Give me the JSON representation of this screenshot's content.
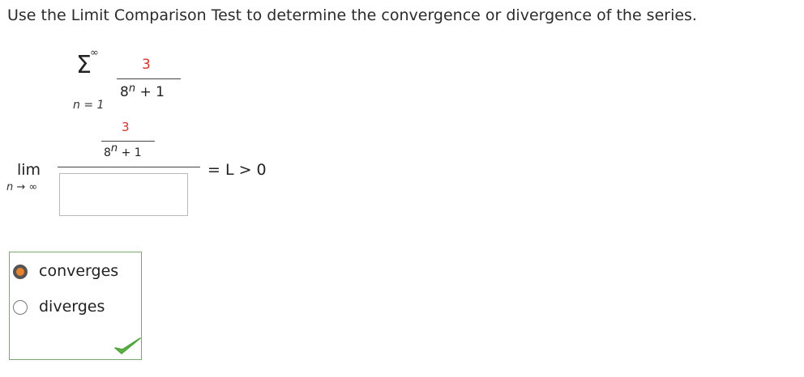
{
  "question": "Use the Limit Comparison Test to determine the convergence or divergence of the series.",
  "series": {
    "upper_limit": "∞",
    "sigma": "Σ",
    "lower_limit": "n = 1",
    "numerator": "3",
    "denominator_base": "8",
    "denominator_exp": "n",
    "denominator_tail": " + 1"
  },
  "limit": {
    "label": "lim",
    "subscript": "n → ∞",
    "inner_numerator": "3",
    "inner_denominator_base": "8",
    "inner_denominator_exp": "n",
    "inner_denominator_tail": " + 1",
    "answer_value": "",
    "result": "= L > 0"
  },
  "choices": [
    {
      "label": "converges",
      "selected": true
    },
    {
      "label": "diverges",
      "selected": false
    }
  ],
  "colors": {
    "accent_red": "#d9322b",
    "radio_selected": "#e8822c",
    "choice_border": "#79a66e",
    "check_green": "#5cb545"
  },
  "icons": {
    "correct": "check-icon"
  }
}
